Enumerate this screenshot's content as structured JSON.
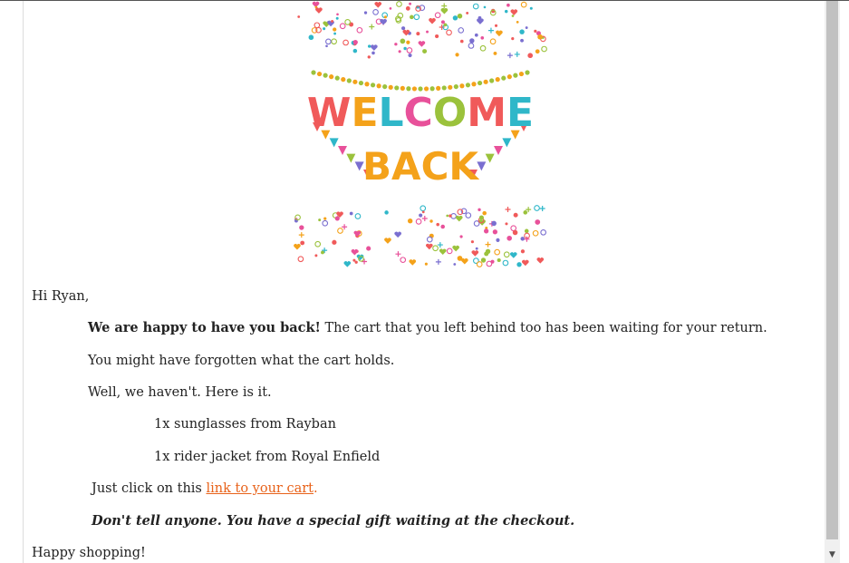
{
  "banner": {
    "line1": "WELCOME",
    "line2": "BACK"
  },
  "email": {
    "greeting": "Hi Ryan,",
    "p1_bold": "We are happy to have you back!",
    "p1_rest": " The cart that you left behind too has been waiting for your return.",
    "p2": "You might have forgotten what the cart holds.",
    "p3": "Well, we haven't. Here is it.",
    "items": [
      "1x sunglasses from Rayban",
      "1x rider jacket from Royal Enfield"
    ],
    "p4_prefix": "Just click on this ",
    "link_text": "link to your cart",
    "p4_suffix": ".",
    "p5": "Don't tell anyone. You have a special gift waiting at the checkout.",
    "closing": "Happy shopping!"
  },
  "scrollbar": {
    "down_arrow": "▼"
  },
  "colors": {
    "link": "#e8621a",
    "welcome_letters": [
      "#f05a5a",
      "#f4a21a",
      "#2fb7c9",
      "#e8519a",
      "#9bc23c",
      "#f05a5a",
      "#2fb7c9"
    ],
    "back": "#f4a21a"
  }
}
